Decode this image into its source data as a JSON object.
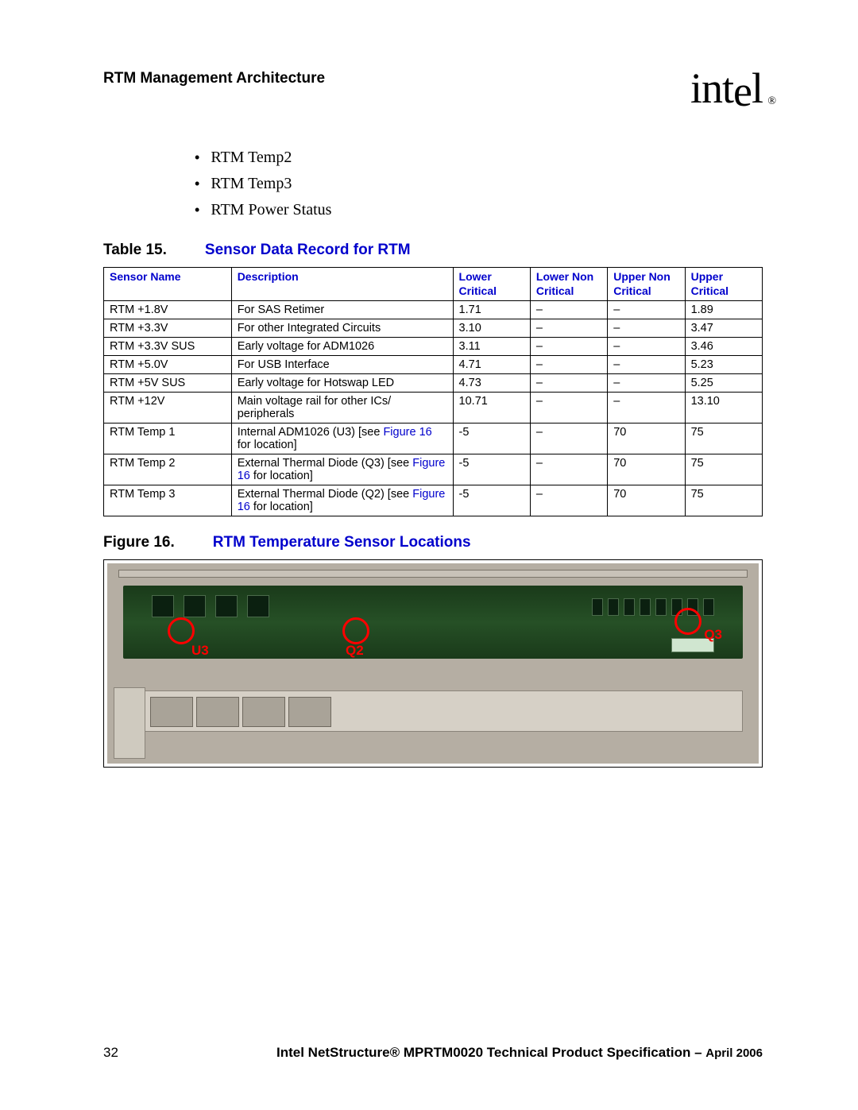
{
  "header": {
    "section": "RTM Management Architecture",
    "logo_text": "intel",
    "logo_reg": "®"
  },
  "bullets": [
    "RTM Temp2",
    "RTM Temp3",
    "RTM Power Status"
  ],
  "table_caption": {
    "label": "Table 15.",
    "title": "Sensor Data Record for RTM"
  },
  "columns": [
    "Sensor Name",
    "Description",
    "Lower Critical",
    "Lower Non Critical",
    "Upper Non Critical",
    "Upper Critical"
  ],
  "figlink_text": "Figure 16",
  "rows": [
    {
      "name": "RTM +1.8V",
      "desc": "For SAS Retimer",
      "lc": "1.71",
      "lnc": "–",
      "unc": "–",
      "uc": "1.89"
    },
    {
      "name": "RTM +3.3V",
      "desc": "For other Integrated Circuits",
      "lc": "3.10",
      "lnc": "–",
      "unc": "–",
      "uc": "3.47"
    },
    {
      "name": "RTM +3.3V SUS",
      "desc": "Early voltage for ADM1026",
      "lc": "3.11",
      "lnc": "–",
      "unc": "–",
      "uc": "3.46"
    },
    {
      "name": "RTM +5.0V",
      "desc": "For USB Interface",
      "lc": "4.71",
      "lnc": "–",
      "unc": "–",
      "uc": "5.23"
    },
    {
      "name": "RTM +5V SUS",
      "desc": "Early voltage for Hotswap LED",
      "lc": "4.73",
      "lnc": "–",
      "unc": "–",
      "uc": "5.25"
    },
    {
      "name": "RTM +12V",
      "desc": "Main voltage rail for other ICs/ peripherals",
      "lc": "10.71",
      "lnc": "–",
      "unc": "–",
      "uc": "13.10"
    },
    {
      "name": "RTM Temp 1",
      "desc_pre": "Internal ADM1026 (U3) [see ",
      "desc_post": " for location]",
      "lc": "-5",
      "lnc": "–",
      "unc": "70",
      "uc": "75",
      "has_link": true
    },
    {
      "name": "RTM Temp 2",
      "desc_pre": "External Thermal Diode (Q3) [see ",
      "desc_post": " for location]",
      "lc": "-5",
      "lnc": "–",
      "unc": "70",
      "uc": "75",
      "has_link": true
    },
    {
      "name": "RTM Temp 3",
      "desc_pre": "External Thermal Diode (Q2) [see ",
      "desc_post": " for location]",
      "lc": "-5",
      "lnc": "–",
      "unc": "70",
      "uc": "75",
      "has_link": true
    }
  ],
  "figure_caption": {
    "label": "Figure 16.",
    "title": "RTM Temperature Sensor Locations"
  },
  "figure_labels": {
    "left": "U3",
    "mid": "Q2",
    "right": "Q3"
  },
  "footer": {
    "page": "32",
    "title": "Intel NetStructure® MPRTM0020 Technical Product Specification",
    "sep": " – ",
    "date": "April 2006"
  }
}
